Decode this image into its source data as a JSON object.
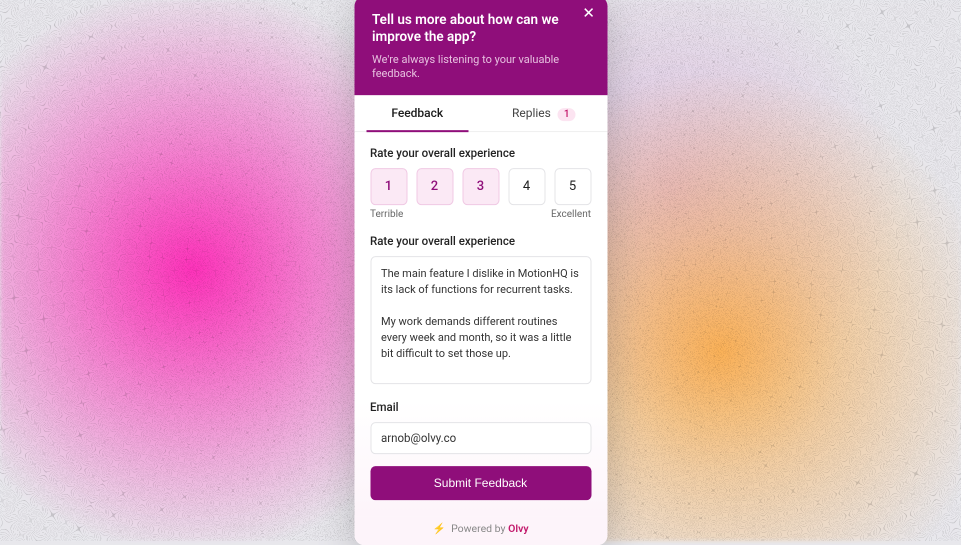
{
  "header": {
    "title": "Tell us more about how can we improve the app?",
    "subtitle": "We're always listening to your valuable feedback."
  },
  "tabs": {
    "feedback_label": "Feedback",
    "replies_label": "Replies",
    "replies_count": "1"
  },
  "rating": {
    "label": "Rate your overall experience",
    "options": [
      "1",
      "2",
      "3",
      "4",
      "5"
    ],
    "selected_max": 3,
    "scale_low": "Terrible",
    "scale_high": "Excellent"
  },
  "feedback": {
    "label": "Rate your overall experience",
    "value": "The main feature I dislike in MotionHQ is its lack of functions for recurrent tasks.\n\nMy work demands different routines every week and month, so it was a little bit difficult to set those up."
  },
  "email": {
    "label": "Email",
    "value": "arnob@olvy.co"
  },
  "submit_label": "Submit Feedback",
  "footer": {
    "powered_by": "Powered by ",
    "brand": "Olvy"
  }
}
